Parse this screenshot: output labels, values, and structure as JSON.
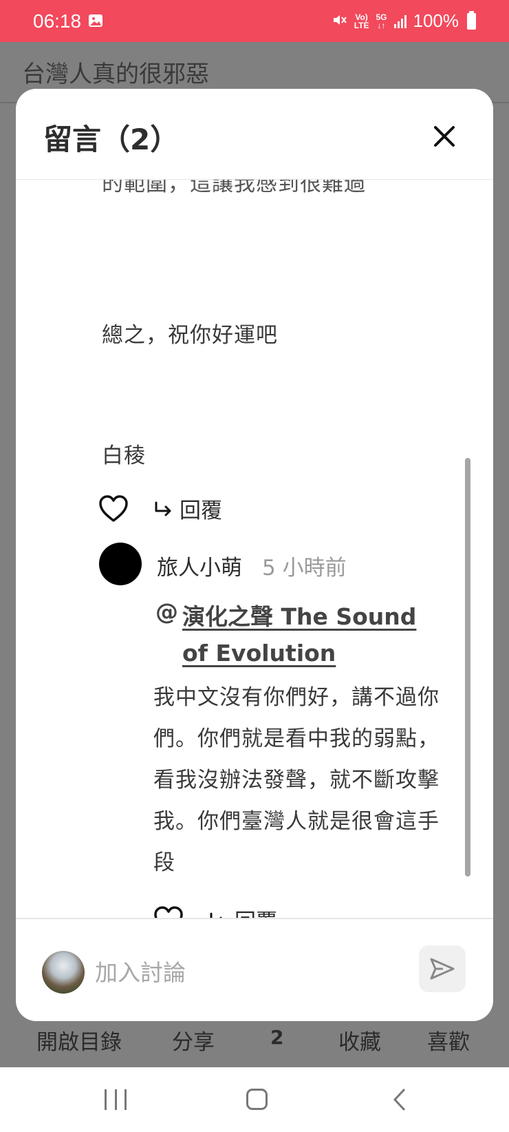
{
  "status_bar": {
    "time": "06:18",
    "volte_top": "Vo)",
    "volte_bottom": "LTE",
    "net_top": "5G",
    "net_bottom": "↓↑",
    "battery": "100%"
  },
  "background_page": {
    "title": "台灣人真的很邪惡",
    "actions": {
      "toc": "開啟目錄",
      "share": "分享",
      "comment_count": "2",
      "collect": "收藏",
      "like": "喜歡"
    }
  },
  "modal": {
    "title": "留言（2）",
    "comments": {
      "clipped_line": "的範圍，這讓我感到很難過",
      "line_zongzhi": "總之，祝你好運吧",
      "signature": "白稜",
      "reply_label": "回覆"
    },
    "reply": {
      "author": "旅人小萌",
      "time": "5 小時前",
      "mention_at": "@",
      "mention_line1": "演化之聲 The Sound ",
      "mention_line2": "of Evolution",
      "body": " 我中文沒有你們好，講不過你們。你們就是看中我的弱點，看我沒辦法發聲，就不斷攻擊我。你們臺灣人就是很會這手段",
      "reply_label": "回覆"
    },
    "composer": {
      "placeholder": "加入討論"
    }
  },
  "colors": {
    "status_bar": "#f2495c",
    "overlay": "#808080",
    "modal_bg": "#ffffff"
  }
}
